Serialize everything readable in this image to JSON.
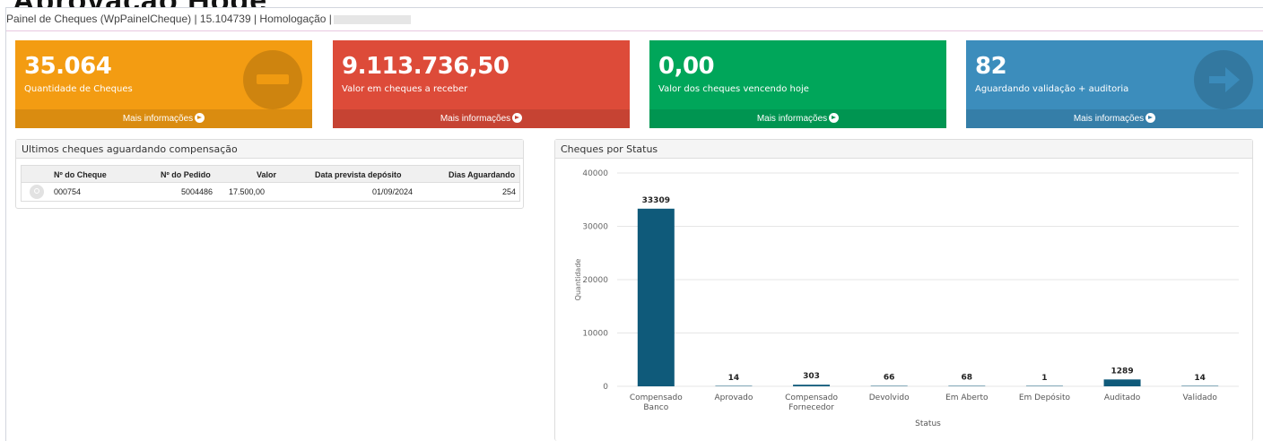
{
  "page": {
    "partial_title": "Aprovação Hoge",
    "header_text": "Painel de Cheques (WpPainelCheque) | 15.104739 | Homologação |"
  },
  "tiles": [
    {
      "value": "35.064",
      "label": "Quantidade de Cheques",
      "more": "Mais informações",
      "icon": "minus-circle-icon",
      "color": "#f39c12"
    },
    {
      "value": "9.113.736,50",
      "label": "Valor em cheques a receber",
      "more": "Mais informações",
      "color": "#dd4b39"
    },
    {
      "value": "0,00",
      "label": "Valor dos cheques vencendo hoje",
      "more": "Mais informações",
      "color": "#00a65a"
    },
    {
      "value": "82",
      "label": "Aguardando validação + auditoria",
      "more": "Mais informações",
      "icon": "arrow-right-circle-icon",
      "color": "#3c8dbc"
    }
  ],
  "pending_panel": {
    "title": "Ultimos cheques aguardando compensação",
    "columns": [
      "Nº do Cheque",
      "Nº do Pedido",
      "Valor",
      "Data prevista depósito",
      "Dias Aguardando"
    ],
    "rows": [
      {
        "cheque": "000754",
        "pedido": "5004486",
        "valor": "17.500,00",
        "data": "01/09/2024",
        "dias": "254"
      }
    ]
  },
  "status_panel": {
    "title": "Cheques por Status"
  },
  "chart_data": {
    "type": "bar",
    "categories": [
      [
        "Compensado",
        "Banco"
      ],
      [
        "Aprovado"
      ],
      [
        "Compensado",
        "Fornecedor"
      ],
      [
        "Devolvido"
      ],
      [
        "Em Aberto"
      ],
      [
        "Em Depósito"
      ],
      [
        "Auditado"
      ],
      [
        "Validado"
      ]
    ],
    "values": [
      33309,
      14,
      303,
      66,
      68,
      1,
      1289,
      14
    ],
    "data_labels": [
      "33309",
      "14",
      "303",
      "66",
      "68",
      "1",
      "1289",
      "14"
    ],
    "xlabel": "Status",
    "ylabel": "Quantidade",
    "ylim": [
      0,
      40000
    ],
    "yticks": [
      "0",
      "10000",
      "20000",
      "30000",
      "40000"
    ],
    "bar_color": "#0f5a7a",
    "grid": true
  }
}
